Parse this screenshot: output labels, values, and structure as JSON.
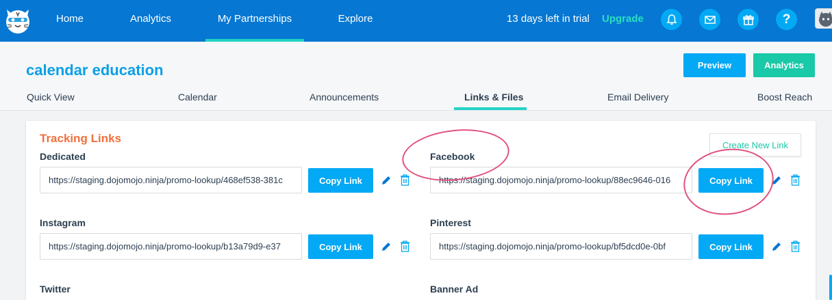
{
  "nav": {
    "items": [
      {
        "label": "Home"
      },
      {
        "label": "Analytics"
      },
      {
        "label": "My Partnerships"
      },
      {
        "label": "Explore"
      }
    ],
    "trial_text": "13 days left in trial",
    "upgrade_label": "Upgrade",
    "icons": [
      "bell-icon",
      "mail-icon",
      "gift-icon",
      "help-icon"
    ],
    "help_glyph": "?"
  },
  "header": {
    "title": "calendar education",
    "preview_label": "Preview",
    "analytics_label": "Analytics"
  },
  "tabs": [
    {
      "label": "Quick View"
    },
    {
      "label": "Calendar"
    },
    {
      "label": "Announcements"
    },
    {
      "label": "Links & Files"
    },
    {
      "label": "Email Delivery"
    },
    {
      "label": "Boost Reach"
    }
  ],
  "tracking": {
    "title": "Tracking Links",
    "create_label": "Create New Link",
    "copy_label": "Copy Link",
    "links": [
      {
        "label": "Dedicated",
        "value": "https://staging.dojomojo.ninja/promo-lookup/468ef538-381c"
      },
      {
        "label": "Facebook",
        "value": "https://staging.dojomojo.ninja/promo-lookup/88ec9646-016"
      },
      {
        "label": "Instagram",
        "value": "https://staging.dojomojo.ninja/promo-lookup/b13a79d9-e37"
      },
      {
        "label": "Pinterest",
        "value": "https://staging.dojomojo.ninja/promo-lookup/bf5dcd0e-0bf"
      },
      {
        "label": "Twitter"
      },
      {
        "label": "Banner Ad"
      }
    ]
  },
  "colors": {
    "nav_bg": "#0677d2",
    "accent_blue": "#03a9f4",
    "accent_teal": "#19c9a7",
    "title_blue": "#0ba0e6",
    "section_orange": "#f0703c",
    "annotation_pink": "#e0517e"
  }
}
